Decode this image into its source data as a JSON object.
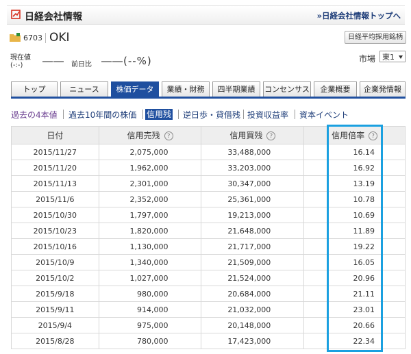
{
  "header": {
    "brand": "日経会社情報",
    "top_link": "日経会社情報トップへ",
    "brand_color": "#d7301f",
    "link_color": "#1d3c78",
    "icons": {
      "logo": "nikkei-logo-icon",
      "chevron": "double-chevron-right-icon"
    }
  },
  "company": {
    "code": "6703",
    "name": "OKI",
    "index_button": "日経平均採用銘柄",
    "icon": "folder-icon"
  },
  "quote": {
    "price_label_line1": "現在値",
    "price_label_line2": "(-:-)",
    "price_value": "――",
    "prev_label": "前日比",
    "prev_value": "――(--%)"
  },
  "market": {
    "label": "市場",
    "selected": "東1"
  },
  "tabs": [
    {
      "label": "トップ"
    },
    {
      "label": "ニュース"
    },
    {
      "label": "株価データ"
    },
    {
      "label": "業績・財務"
    },
    {
      "label": "四半期業績"
    },
    {
      "label": "コンセンサス"
    },
    {
      "label": "企業概要"
    },
    {
      "label": "企業発情報"
    }
  ],
  "active_tab": "株価データ",
  "accent_color": "#1f4f9f",
  "subnav": [
    {
      "label": "過去の4本値"
    },
    {
      "label": "過去10年間の株価"
    },
    {
      "label": "信用残"
    },
    {
      "label": "逆日歩・貸借残"
    },
    {
      "label": "投資収益率"
    },
    {
      "label": "資本イベント"
    }
  ],
  "table": {
    "headers": [
      "日付",
      "信用売残",
      "信用買残",
      "信用倍率"
    ],
    "help_glyph": "?",
    "rows": [
      [
        "2015/11/27",
        "2,075,000",
        "33,488,000",
        "16.14"
      ],
      [
        "2015/11/20",
        "1,962,000",
        "33,203,000",
        "16.92"
      ],
      [
        "2015/11/13",
        "2,301,000",
        "30,347,000",
        "13.19"
      ],
      [
        "2015/11/6",
        "2,352,000",
        "25,361,000",
        "10.78"
      ],
      [
        "2015/10/30",
        "1,797,000",
        "19,213,000",
        "10.69"
      ],
      [
        "2015/10/23",
        "1,820,000",
        "21,648,000",
        "11.89"
      ],
      [
        "2015/10/16",
        "1,130,000",
        "21,717,000",
        "19.22"
      ],
      [
        "2015/10/9",
        "1,340,000",
        "21,509,000",
        "16.05"
      ],
      [
        "2015/10/2",
        "1,027,000",
        "21,524,000",
        "20.96"
      ],
      [
        "2015/9/18",
        "980,000",
        "20,684,000",
        "21.11"
      ],
      [
        "2015/9/11",
        "914,000",
        "21,032,000",
        "23.01"
      ],
      [
        "2015/9/4",
        "975,000",
        "20,148,000",
        "20.66"
      ],
      [
        "2015/8/28",
        "780,000",
        "17,423,000",
        "22.34"
      ]
    ],
    "highlight_color": "#1aa0e0"
  }
}
